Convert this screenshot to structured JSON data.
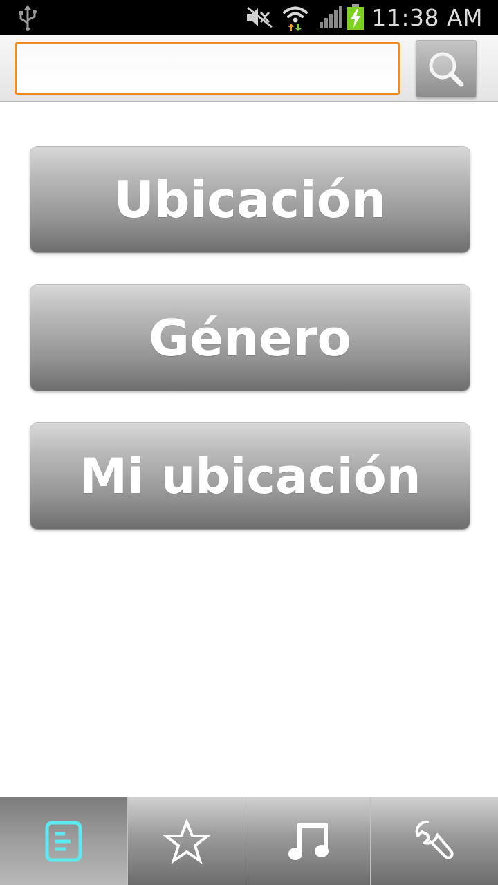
{
  "status_bar": {
    "time": "11:38 AM",
    "icons": [
      "usb-icon",
      "mute-icon",
      "wifi-icon",
      "signal-icon",
      "battery-charging-icon"
    ]
  },
  "search": {
    "value": "",
    "placeholder": "",
    "button_icon": "search-icon"
  },
  "menu": {
    "items": [
      {
        "label": "Ubicación"
      },
      {
        "label": "Género"
      },
      {
        "label": "Mi ubicación"
      }
    ]
  },
  "tabs": [
    {
      "icon": "list-icon",
      "active": true
    },
    {
      "icon": "star-icon",
      "active": false
    },
    {
      "icon": "music-note-icon",
      "active": false
    },
    {
      "icon": "wrench-icon",
      "active": false
    }
  ],
  "colors": {
    "search_border": "#f08c1c",
    "active_tab_icon": "#5ee8f0"
  }
}
